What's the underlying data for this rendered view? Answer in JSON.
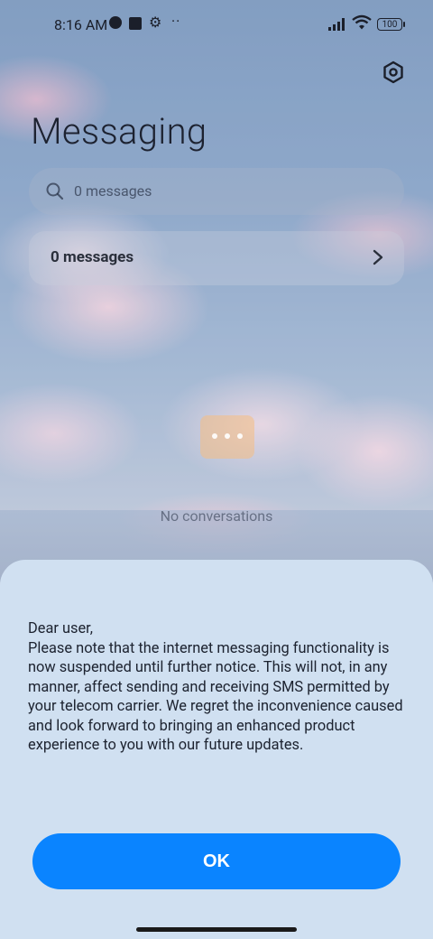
{
  "status_bar": {
    "time": "8:16 AM",
    "battery": "100"
  },
  "header": {
    "title": "Messaging"
  },
  "search": {
    "placeholder": "0 messages"
  },
  "summary_row": {
    "label": "0 messages"
  },
  "empty_state": {
    "text": "No conversations"
  },
  "dialog": {
    "message": "Dear user,\nPlease note that the internet messaging functionality is now suspended until further notice. This will not, in any manner, affect sending and receiving SMS permitted by your telecom carrier. We regret the inconvenience caused and look forward to bringing an enhanced product experience to you with our future updates.",
    "ok_label": "OK"
  },
  "colors": {
    "accent": "#0a84ff",
    "sheet": "#d0e0f1"
  }
}
